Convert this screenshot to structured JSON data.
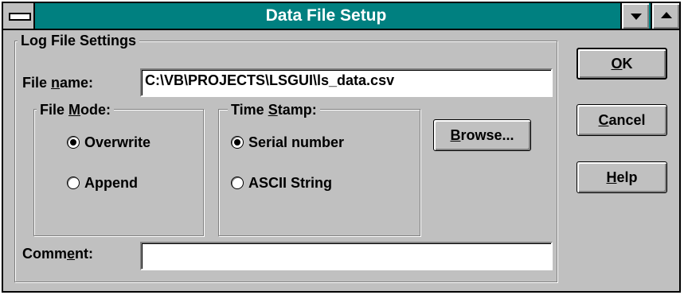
{
  "window": {
    "title": "Data File Setup"
  },
  "log_settings": {
    "legend": "Log File Settings",
    "file_name": {
      "label_pre": "File ",
      "label_key": "n",
      "label_post": "ame:",
      "value": "C:\\VB\\PROJECTS\\LSGUI\\ls_data.csv"
    },
    "file_mode": {
      "legend_pre": "File ",
      "legend_key": "M",
      "legend_post": "ode:",
      "options": [
        {
          "label": "Overwrite",
          "selected": true
        },
        {
          "label": "Append",
          "selected": false
        }
      ]
    },
    "time_stamp": {
      "legend_pre": "Time ",
      "legend_key": "S",
      "legend_post": "tamp:",
      "options": [
        {
          "label": "Serial number",
          "selected": true
        },
        {
          "label": "ASCII String",
          "selected": false
        }
      ]
    },
    "browse": {
      "key": "B",
      "rest": "rowse..."
    },
    "comment": {
      "label_pre": "Comm",
      "label_key": "e",
      "label_post": "nt:",
      "value": ""
    }
  },
  "buttons": {
    "ok": {
      "key": "O",
      "rest": "K"
    },
    "cancel": {
      "key": "C",
      "rest": "ancel"
    },
    "help": {
      "key": "H",
      "rest": "elp"
    }
  },
  "colors": {
    "title_bar": "#008080",
    "face": "#c0c0c0",
    "shadow": "#808080",
    "highlight": "#ffffff"
  }
}
